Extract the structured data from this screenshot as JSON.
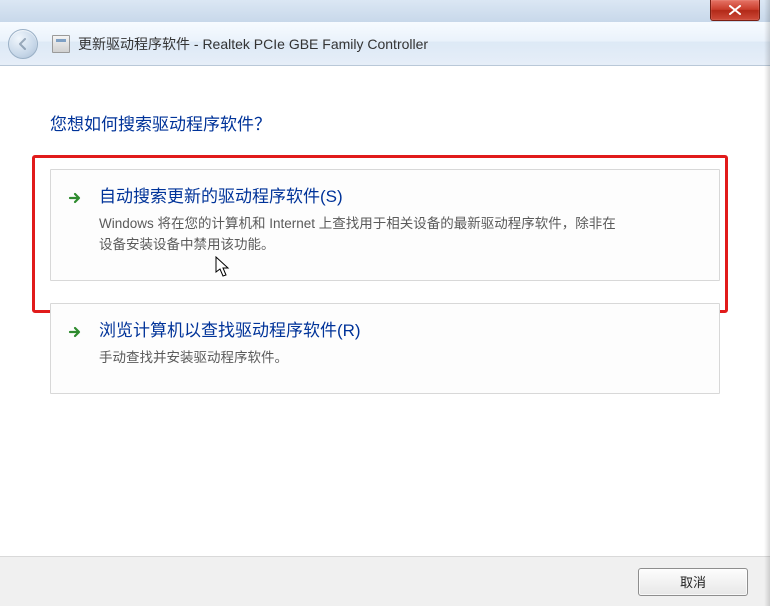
{
  "window": {
    "title": "更新驱动程序软件 - Realtek PCIe GBE Family Controller"
  },
  "heading": "您想如何搜索驱动程序软件？",
  "options": [
    {
      "title": "自动搜索更新的驱动程序软件(S)",
      "desc": "Windows 将在您的计算机和 Internet 上查找用于相关设备的最新驱动程序软件，除非在设备安装设备中禁用该功能。"
    },
    {
      "title": "浏览计算机以查找驱动程序软件(R)",
      "desc": "手动查找并安装驱动程序软件。"
    }
  ],
  "buttons": {
    "cancel": "取消"
  }
}
